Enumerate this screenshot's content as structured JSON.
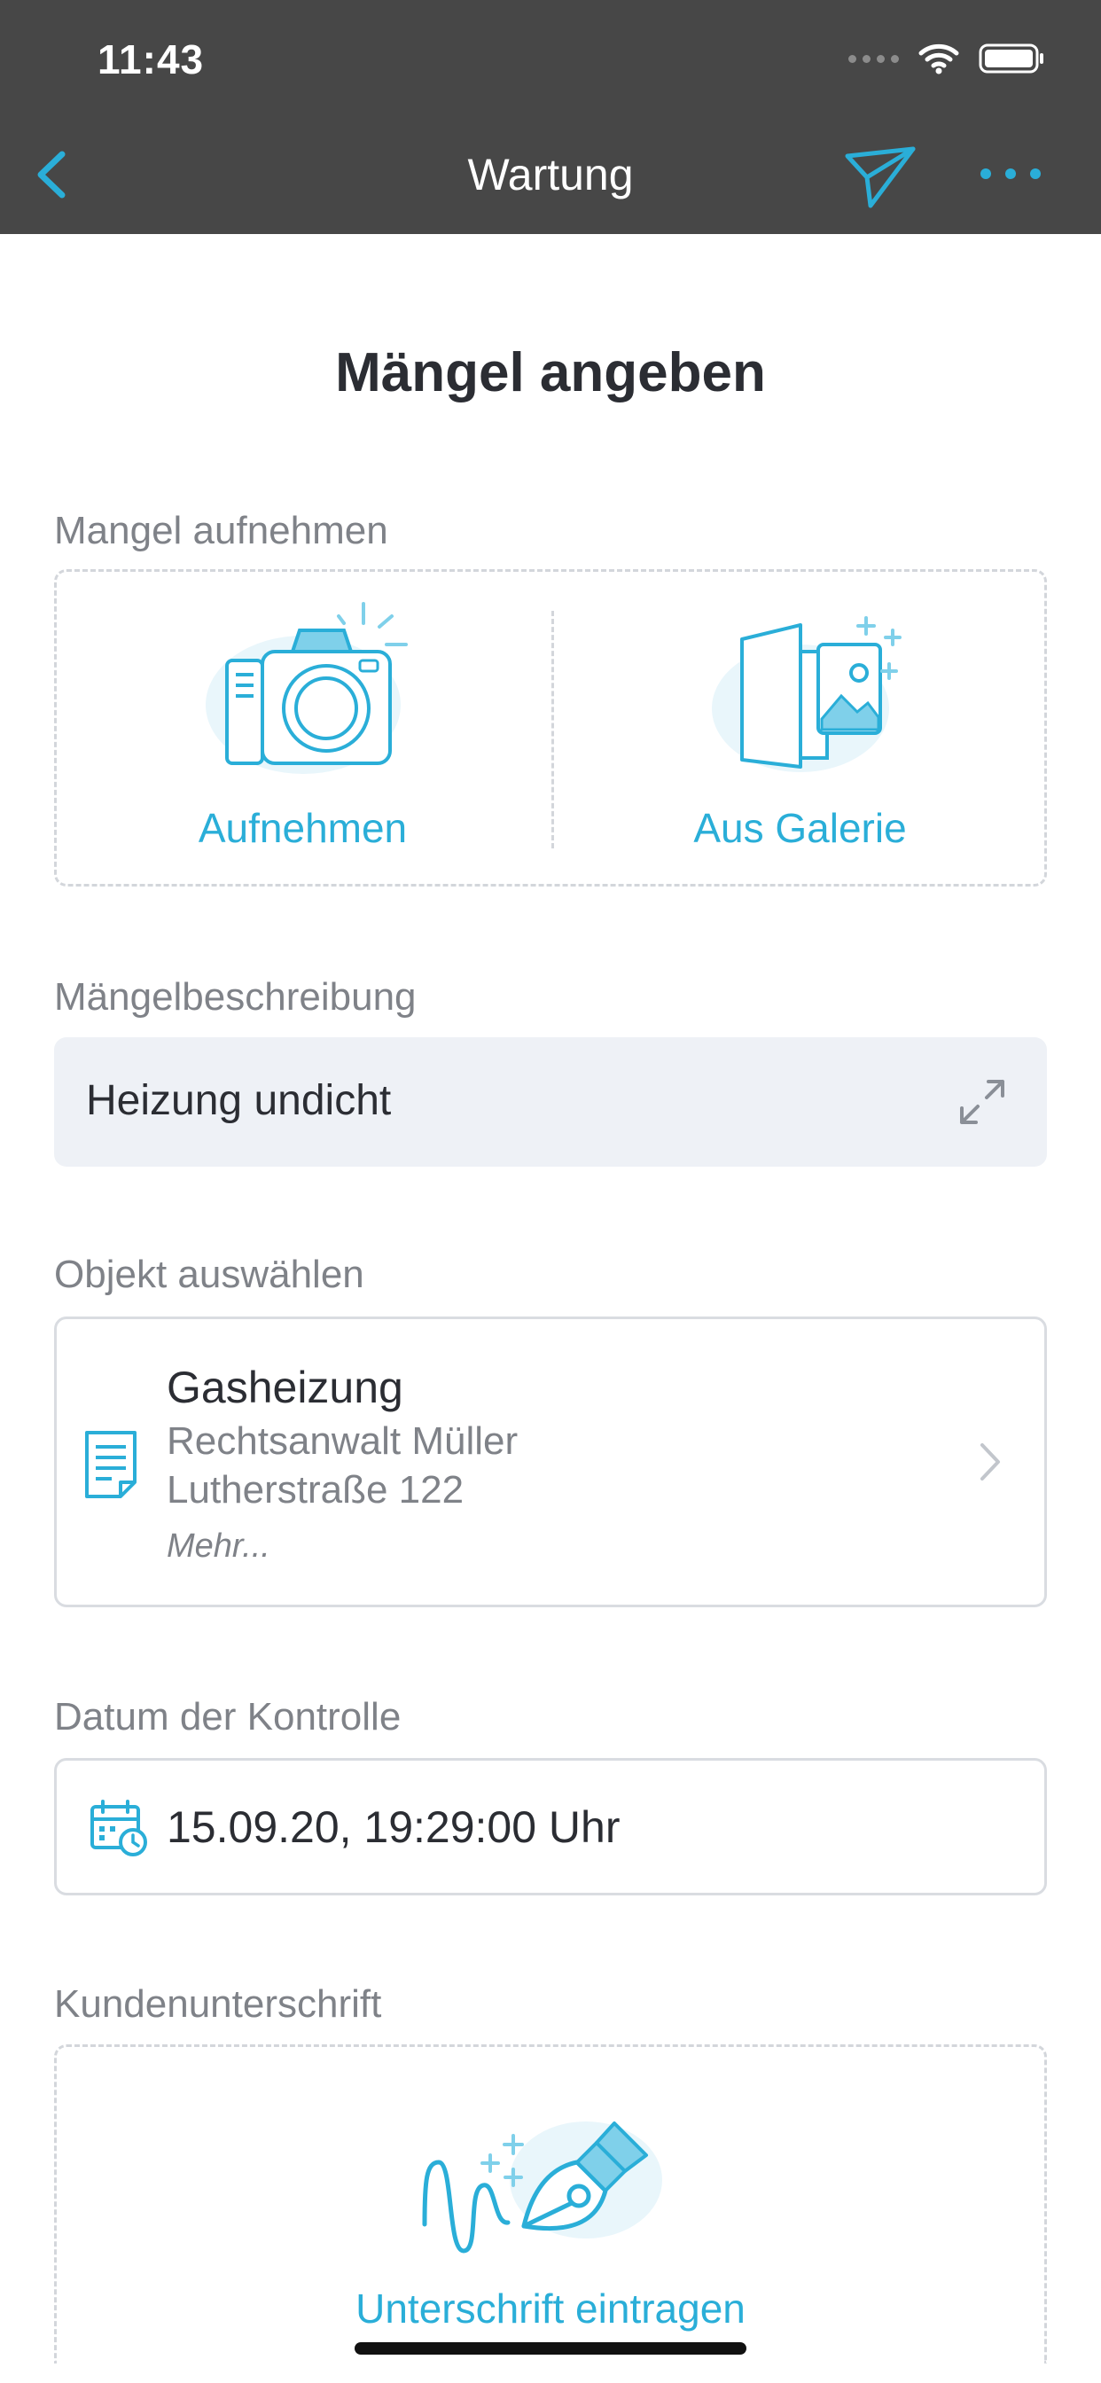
{
  "status_bar": {
    "time": "11:43"
  },
  "nav": {
    "title": "Wartung"
  },
  "page": {
    "title": "Mängel angeben"
  },
  "capture": {
    "label": "Mangel aufnehmen",
    "camera_label": "Aufnehmen",
    "gallery_label": "Aus Galerie"
  },
  "description": {
    "label": "Mängelbeschreibung",
    "value": "Heizung undicht"
  },
  "object": {
    "label": "Objekt auswählen",
    "name": "Gasheizung",
    "line1": "Rechtsanwalt Müller",
    "line2": "Lutherstraße 122",
    "more": "Mehr..."
  },
  "date": {
    "label": "Datum der Kontrolle",
    "value": "15.09.20, 19:29:00 Uhr"
  },
  "signature": {
    "label": "Kundenunterschrift",
    "button_label": "Unterschrift eintragen"
  },
  "colors": {
    "accent": "#2aaed8",
    "nav_bg": "#474747",
    "field_bg": "#eef1f6",
    "muted_text": "#7f8288"
  }
}
